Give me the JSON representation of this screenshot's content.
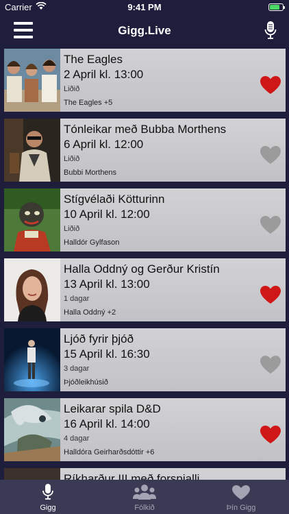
{
  "status_bar": {
    "carrier": "Carrier",
    "time": "9:41 PM"
  },
  "nav": {
    "title": "Gigg.Live",
    "menu_icon": "hamburger-menu-icon",
    "right_icon": "microphone-icon"
  },
  "events": [
    {
      "title": "The Eagles",
      "date": "2 April kl. 13:00",
      "status": "Liðið",
      "artists": "The Eagles +5",
      "favorite": true
    },
    {
      "title": "Tónleikar með Bubba Morthens",
      "date": "6 April kl. 12:00",
      "status": "Liðið",
      "artists": "Bubbi Morthens",
      "favorite": false
    },
    {
      "title": "Stígvélaði Kötturinn",
      "date": "10 April kl. 12:00",
      "status": "Liðið",
      "artists": "Halldór Gylfason",
      "favorite": false
    },
    {
      "title": "Halla Oddný og Gerður Kristín",
      "date": "13 April kl. 13:00",
      "status": "1 dagar",
      "artists": "Halla Oddný +2",
      "favorite": true
    },
    {
      "title": "Ljóð fyrir þjóð",
      "date": "15 April kl. 16:30",
      "status": "3 dagar",
      "artists": "Þjóðleikhúsið",
      "favorite": false
    },
    {
      "title": "Leikarar spila D&D",
      "date": "16 April kl. 14:00",
      "status": "4 dagar",
      "artists": "Halldóra Geirharðsdóttir +6",
      "favorite": true
    },
    {
      "title": "Ríkharður III með forspjalli",
      "date": "",
      "status": "",
      "artists": "",
      "favorite": false
    }
  ],
  "tabs": [
    {
      "label": "Gigg",
      "icon": "microphone-icon",
      "active": true
    },
    {
      "label": "Fólkið",
      "icon": "people-icon",
      "active": false
    },
    {
      "label": "Þín Gigg",
      "icon": "heart-icon",
      "active": false
    }
  ],
  "colors": {
    "background": "#1f1d3c",
    "tab_bar": "#3b3a54",
    "heart_active": "#d01717",
    "heart_inactive": "#9b9b9b",
    "tab_active": "#ffffff",
    "tab_inactive": "#a4a3b3"
  }
}
